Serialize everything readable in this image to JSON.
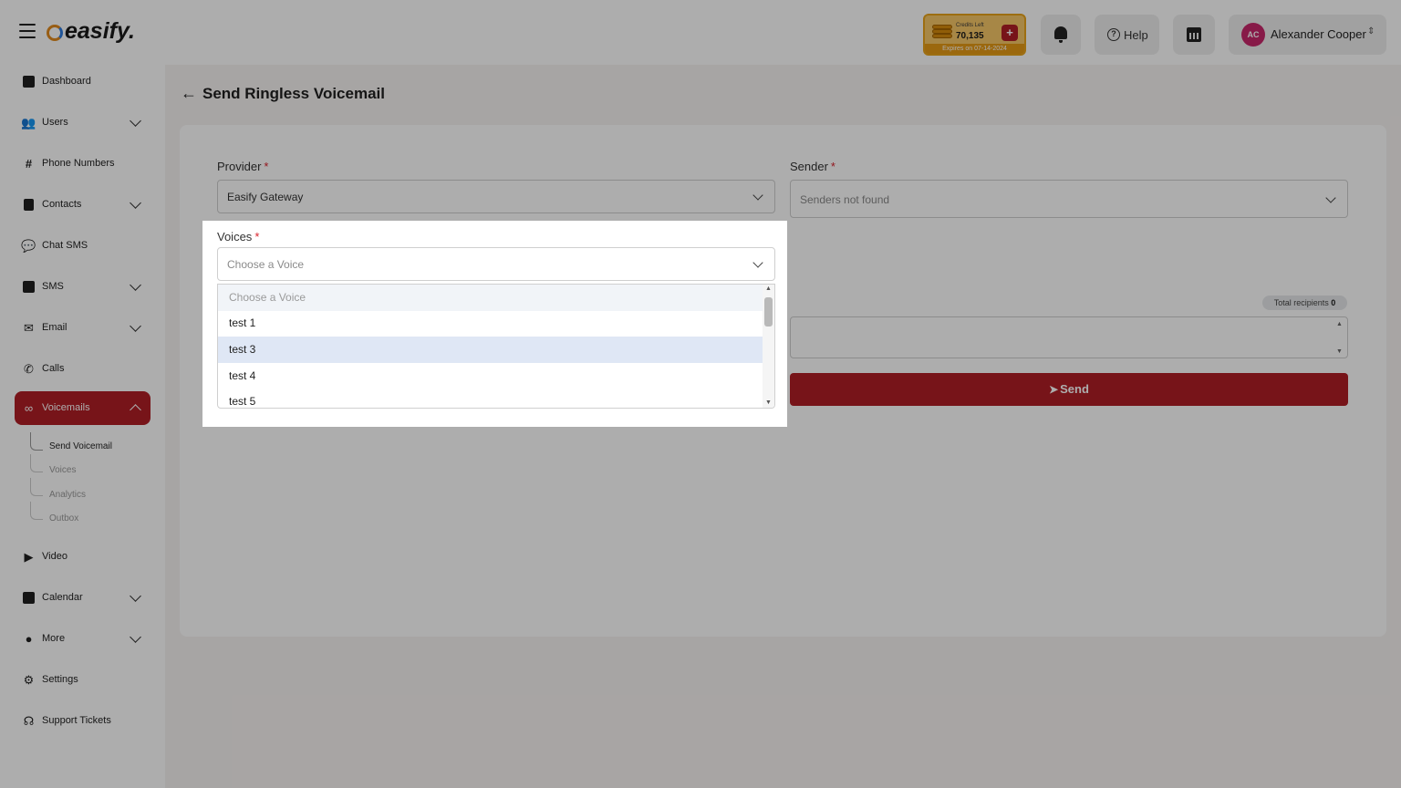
{
  "app": {
    "logo": "easify."
  },
  "topbar": {
    "credits_label": "Credits Left",
    "credits_value": "70,135",
    "credits_expiry": "Expires on 07-14-2024",
    "help_label": "Help",
    "user_initials": "AC",
    "user_name": "Alexander Cooper"
  },
  "sidebar": {
    "items": [
      {
        "label": "Dashboard"
      },
      {
        "label": "Users"
      },
      {
        "label": "Phone Numbers"
      },
      {
        "label": "Contacts"
      },
      {
        "label": "Chat SMS"
      },
      {
        "label": "SMS"
      },
      {
        "label": "Email"
      },
      {
        "label": "Calls"
      },
      {
        "label": "Voicemails"
      },
      {
        "label": "Video"
      },
      {
        "label": "Calendar"
      },
      {
        "label": "More"
      },
      {
        "label": "Settings"
      },
      {
        "label": "Support Tickets"
      }
    ],
    "voicemail_sub": [
      "Send Voicemail",
      "Voices",
      "Analytics",
      "Outbox"
    ]
  },
  "page": {
    "title": "Send Ringless Voicemail"
  },
  "form": {
    "provider_label": "Provider",
    "provider_value": "Easify Gateway",
    "sender_label": "Sender",
    "sender_value": "Senders not found",
    "voices_label": "Voices",
    "voices_placeholder": "Choose a Voice",
    "required_mark": "*",
    "recipients_label": "Total recipients",
    "recipients_count": "0",
    "send_label": "Send"
  },
  "voice_dropdown": {
    "options": [
      "Choose a Voice",
      "test 1",
      "test 3",
      "test 4",
      "test 5"
    ],
    "highlighted": "test 3"
  },
  "colors": {
    "brand": "#b01e25",
    "credits": "#e7a21a",
    "avatar": "#c8276b"
  }
}
